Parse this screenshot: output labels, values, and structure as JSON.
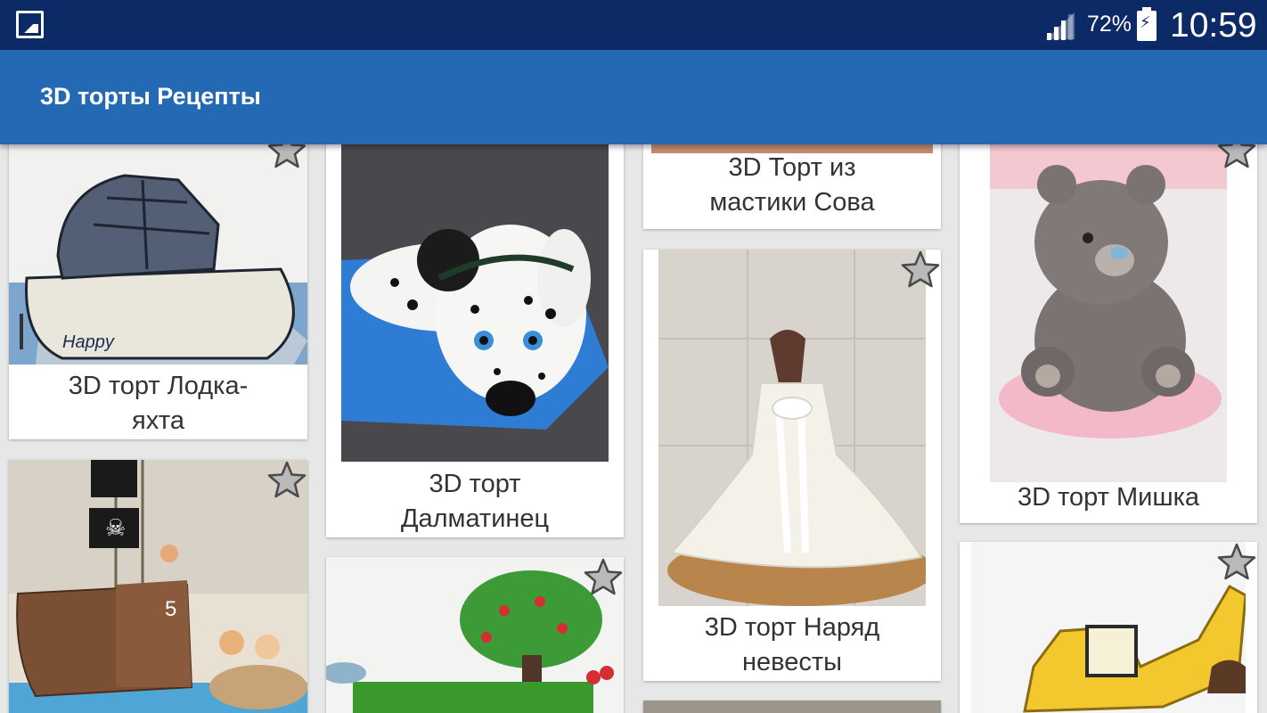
{
  "status": {
    "battery_pct": "72%",
    "time": "10:59"
  },
  "app": {
    "title": "3D торты Рецепты"
  },
  "cards": [
    {
      "title": "3D торт Лодка-\nяхта"
    },
    {
      "title": "3D торт\nДалматинец"
    },
    {
      "title": "3D Торт из\nмастики Сова"
    },
    {
      "title": "3D торт Наряд\nневесты"
    },
    {
      "title": "3D торт Мишка"
    }
  ],
  "icons": {
    "favorite": "star-icon",
    "gallery": "image-icon",
    "signal": "signal-icon",
    "battery": "battery-charging-icon"
  },
  "colors": {
    "status_bar": "#0c2a66",
    "app_bar": "#2469b4",
    "background": "#e7e7e7",
    "card": "#ffffff",
    "star_fill": "#b9b9b9"
  }
}
